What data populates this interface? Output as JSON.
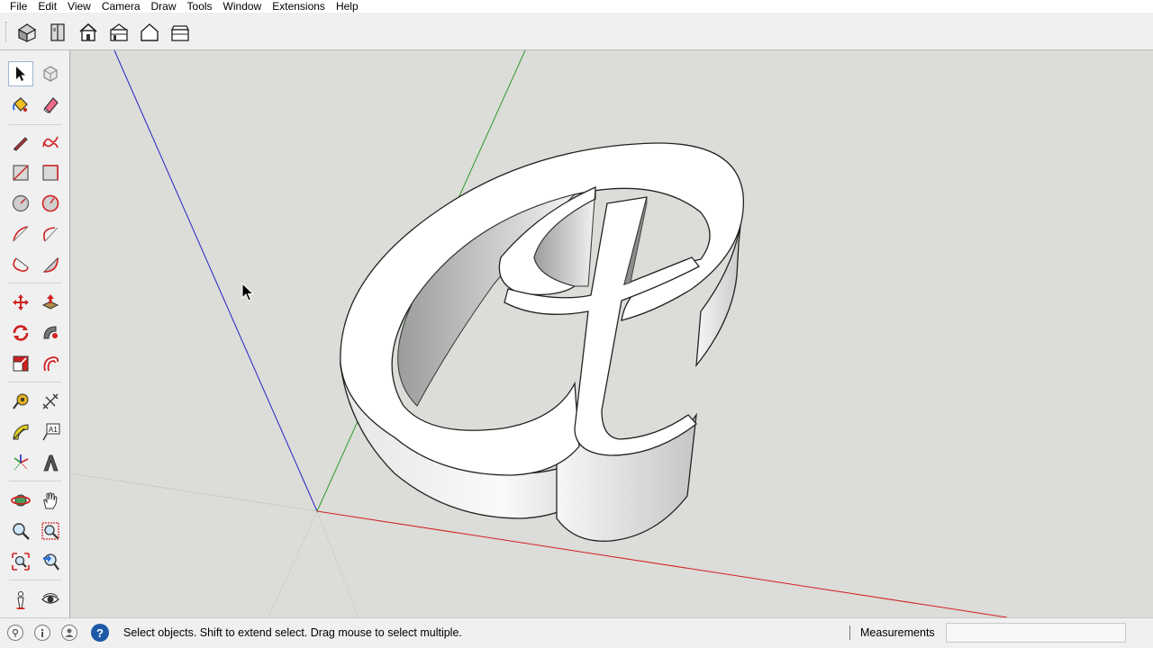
{
  "menu": {
    "items": [
      "File",
      "Edit",
      "View",
      "Camera",
      "Draw",
      "Tools",
      "Window",
      "Extensions",
      "Help"
    ]
  },
  "toolbar": {
    "views": [
      {
        "name": "iso-view",
        "icon": "iso-house-icon"
      },
      {
        "name": "top-view",
        "icon": "top-view-icon"
      },
      {
        "name": "front-view",
        "icon": "front-house-icon"
      },
      {
        "name": "right-view",
        "icon": "right-house-icon"
      },
      {
        "name": "back-view",
        "icon": "back-house-icon"
      },
      {
        "name": "left-view",
        "icon": "left-house-icon"
      }
    ]
  },
  "tools": [
    "select",
    "make-component",
    "paint-bucket",
    "eraser",
    "line",
    "freehand",
    "rectangle",
    "rotated-rectangle",
    "circle",
    "polygon",
    "arc",
    "two-point-arc",
    "three-point-arc",
    "pie",
    "move",
    "push-pull",
    "rotate",
    "follow-me",
    "scale",
    "offset",
    "tape-measure",
    "dimension",
    "protractor",
    "text",
    "axes",
    "3d-text",
    "orbit",
    "pan",
    "zoom",
    "zoom-window",
    "zoom-extents",
    "previous-view",
    "position-camera",
    "look-around"
  ],
  "status": {
    "text": "Select objects. Shift to extend select. Drag mouse to select multiple.",
    "measurements_label": "Measurements",
    "measurements_value": ""
  },
  "colors": {
    "red_axis": "#d22020",
    "green_axis": "#2e9b2e",
    "blue_axis": "#2323c4",
    "viewport_bg": "#dcdcd8",
    "help_blue": "#1f5aa8"
  }
}
